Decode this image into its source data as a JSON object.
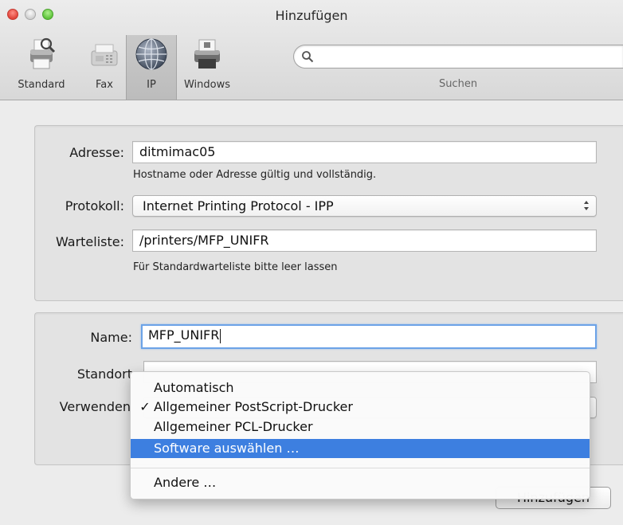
{
  "window": {
    "title": "Hinzufügen"
  },
  "toolbar": {
    "items": [
      {
        "label": "Standard",
        "icon": "printer-magnifier-icon"
      },
      {
        "label": "Fax",
        "icon": "fax-icon"
      },
      {
        "label": "IP",
        "icon": "globe-icon"
      },
      {
        "label": "Windows",
        "icon": "windows-printer-icon"
      }
    ],
    "search_placeholder": "",
    "search_label": "Suchen"
  },
  "connection": {
    "address_label": "Adresse:",
    "address_value": "ditmimac05",
    "address_hint": "Hostname oder Adresse gültig und vollständig.",
    "protocol_label": "Protokoll:",
    "protocol_value": "Internet Printing Protocol - IPP",
    "queue_label": "Warteliste:",
    "queue_value": "/printers/MFP_UNIFR",
    "queue_hint": "Für Standardwarteliste bitte leer lassen"
  },
  "printer": {
    "name_label": "Name:",
    "name_value": "MFP_UNIFR",
    "location_label": "Standort",
    "location_value": "",
    "use_label": "Verwenden"
  },
  "menu": {
    "items": [
      {
        "label": "Automatisch",
        "checked": false,
        "highlighted": false
      },
      {
        "label": "Allgemeiner PostScript-Drucker",
        "checked": true,
        "highlighted": false
      },
      {
        "label": "Allgemeiner PCL-Drucker",
        "checked": false,
        "highlighted": false
      },
      {
        "label": "Software auswählen …",
        "checked": false,
        "highlighted": true
      }
    ],
    "other_label": "Andere …",
    "check_glyph": "✓"
  },
  "footer": {
    "add_button": "Hinzufügen"
  },
  "colors": {
    "highlight": "#3d7fe0",
    "focus_ring": "#6ca3e7",
    "close": "#e0443a",
    "zoom": "#5dc33a"
  }
}
